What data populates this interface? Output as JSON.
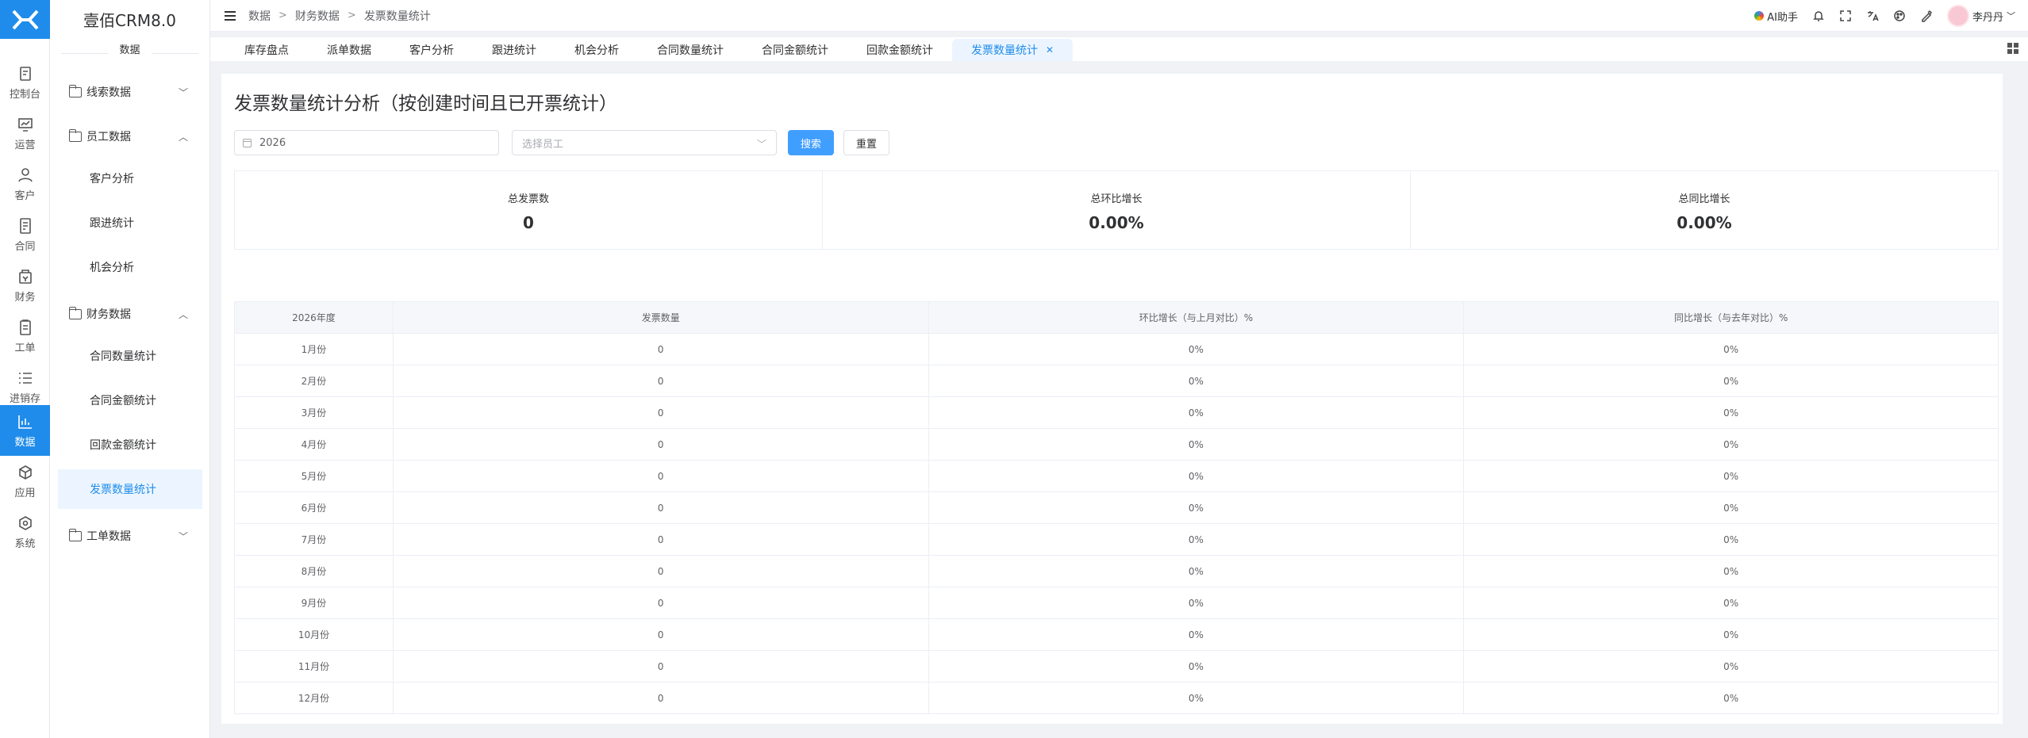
{
  "rail": {
    "items": [
      {
        "label": "控制台",
        "icon": "dashboard-icon"
      },
      {
        "label": "运营",
        "icon": "operations-icon"
      },
      {
        "label": "客户",
        "icon": "customer-icon"
      },
      {
        "label": "合同",
        "icon": "contract-icon"
      },
      {
        "label": "财务",
        "icon": "finance-icon"
      },
      {
        "label": "工单",
        "icon": "work-order-icon"
      },
      {
        "label": "进销存",
        "icon": "inventory-icon"
      },
      {
        "label": "数据",
        "icon": "data-chart-icon",
        "active": true
      },
      {
        "label": "应用",
        "icon": "apps-icon"
      },
      {
        "label": "系统",
        "icon": "system-icon"
      }
    ]
  },
  "sidebar": {
    "brand": "壹佰CRM8.0",
    "section": "数据",
    "groups": [
      {
        "label": "线索数据",
        "expanded": false
      },
      {
        "label": "员工数据",
        "expanded": true,
        "children": [
          "客户分析",
          "跟进统计",
          "机会分析"
        ]
      },
      {
        "label": "财务数据",
        "expanded": true,
        "children": [
          "合同数量统计",
          "合同金额统计",
          "回款金额统计",
          "发票数量统计"
        ]
      },
      {
        "label": "工单数据",
        "expanded": false
      }
    ],
    "active_child": "发票数量统计"
  },
  "header": {
    "breadcrumb": [
      "数据",
      "财务数据",
      "发票数量统计"
    ],
    "ai_label": "AI助手",
    "user_name": "李丹丹"
  },
  "tabs": [
    {
      "label": "库存盘点"
    },
    {
      "label": "派单数据"
    },
    {
      "label": "客户分析"
    },
    {
      "label": "跟进统计"
    },
    {
      "label": "机会分析"
    },
    {
      "label": "合同数量统计"
    },
    {
      "label": "合同金额统计"
    },
    {
      "label": "回款金额统计"
    },
    {
      "label": "发票数量统计",
      "active": true,
      "closable": true
    }
  ],
  "page": {
    "title": "发票数量统计分析（按创建时间且已开票统计）",
    "filters": {
      "year_value": "2026",
      "employee_placeholder": "选择员工",
      "search_label": "搜索",
      "reset_label": "重置"
    },
    "stats": [
      {
        "label": "总发票数",
        "value": "0"
      },
      {
        "label": "总环比增长",
        "value": "0.00%"
      },
      {
        "label": "总同比增长",
        "value": "0.00%"
      }
    ],
    "table": {
      "headers": [
        "2026年度",
        "发票数量",
        "环比增长（与上月对比）%",
        "同比增长（与去年对比）%"
      ],
      "rows": [
        [
          "1月份",
          "0",
          "0%",
          "0%"
        ],
        [
          "2月份",
          "0",
          "0%",
          "0%"
        ],
        [
          "3月份",
          "0",
          "0%",
          "0%"
        ],
        [
          "4月份",
          "0",
          "0%",
          "0%"
        ],
        [
          "5月份",
          "0",
          "0%",
          "0%"
        ],
        [
          "6月份",
          "0",
          "0%",
          "0%"
        ],
        [
          "7月份",
          "0",
          "0%",
          "0%"
        ],
        [
          "8月份",
          "0",
          "0%",
          "0%"
        ],
        [
          "9月份",
          "0",
          "0%",
          "0%"
        ],
        [
          "10月份",
          "0",
          "0%",
          "0%"
        ],
        [
          "11月份",
          "0",
          "0%",
          "0%"
        ],
        [
          "12月份",
          "0",
          "0%",
          "0%"
        ]
      ]
    }
  },
  "colors": {
    "accent": "#1f8ceb",
    "primary_button": "#409eff",
    "active_bg": "#ecf5ff"
  }
}
